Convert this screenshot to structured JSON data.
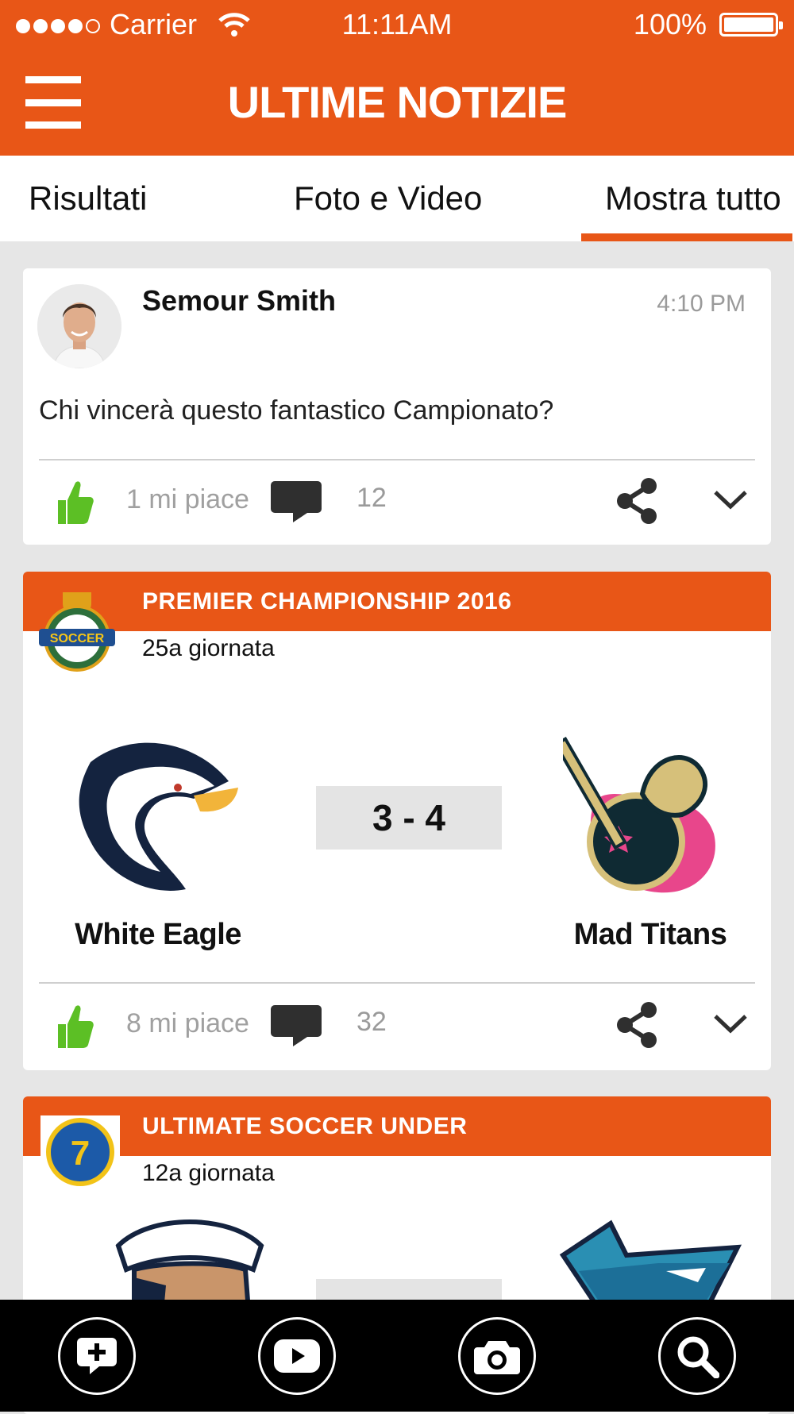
{
  "status_bar": {
    "carrier": "Carrier",
    "time": "11:11AM",
    "battery_percent": "100%",
    "signal_bars": 4,
    "signal_total": 5
  },
  "header": {
    "title": "ULTIME NOTIZIE",
    "menu_icon": "hamburger-menu-icon"
  },
  "tabs": [
    {
      "label": "Risultati",
      "active": false
    },
    {
      "label": "Foto e Video",
      "active": false
    },
    {
      "label": "Mostra tutto",
      "active": true
    }
  ],
  "post": {
    "author": "Semour Smith",
    "time": "4:10 PM",
    "text": "Chi vincerà questo fantastico Campionato?",
    "likes_text": "1 mi piace",
    "comments": "12"
  },
  "matches": [
    {
      "league": "PREMIER CHAMPIONSHIP 2016",
      "round": "25a giornata",
      "home_team": "White Eagle",
      "away_team": "Mad Titans",
      "score": "3 - 4",
      "likes_text": "8 mi piace",
      "comments": "32"
    },
    {
      "league": "ULTIMATE SOCCER UNDER",
      "round": "12a giornata"
    }
  ],
  "logo_texts": {
    "soccer_badge": "SOCCER",
    "futsal_badge": "7"
  },
  "bottom_toolbar": [
    {
      "icon": "add-post-icon"
    },
    {
      "icon": "video-play-icon"
    },
    {
      "icon": "camera-icon"
    },
    {
      "icon": "search-icon"
    }
  ],
  "colors": {
    "accent": "#e85617",
    "like_green": "#5cbf25",
    "background": "#e6e6e6",
    "toolbar": "#000000"
  }
}
